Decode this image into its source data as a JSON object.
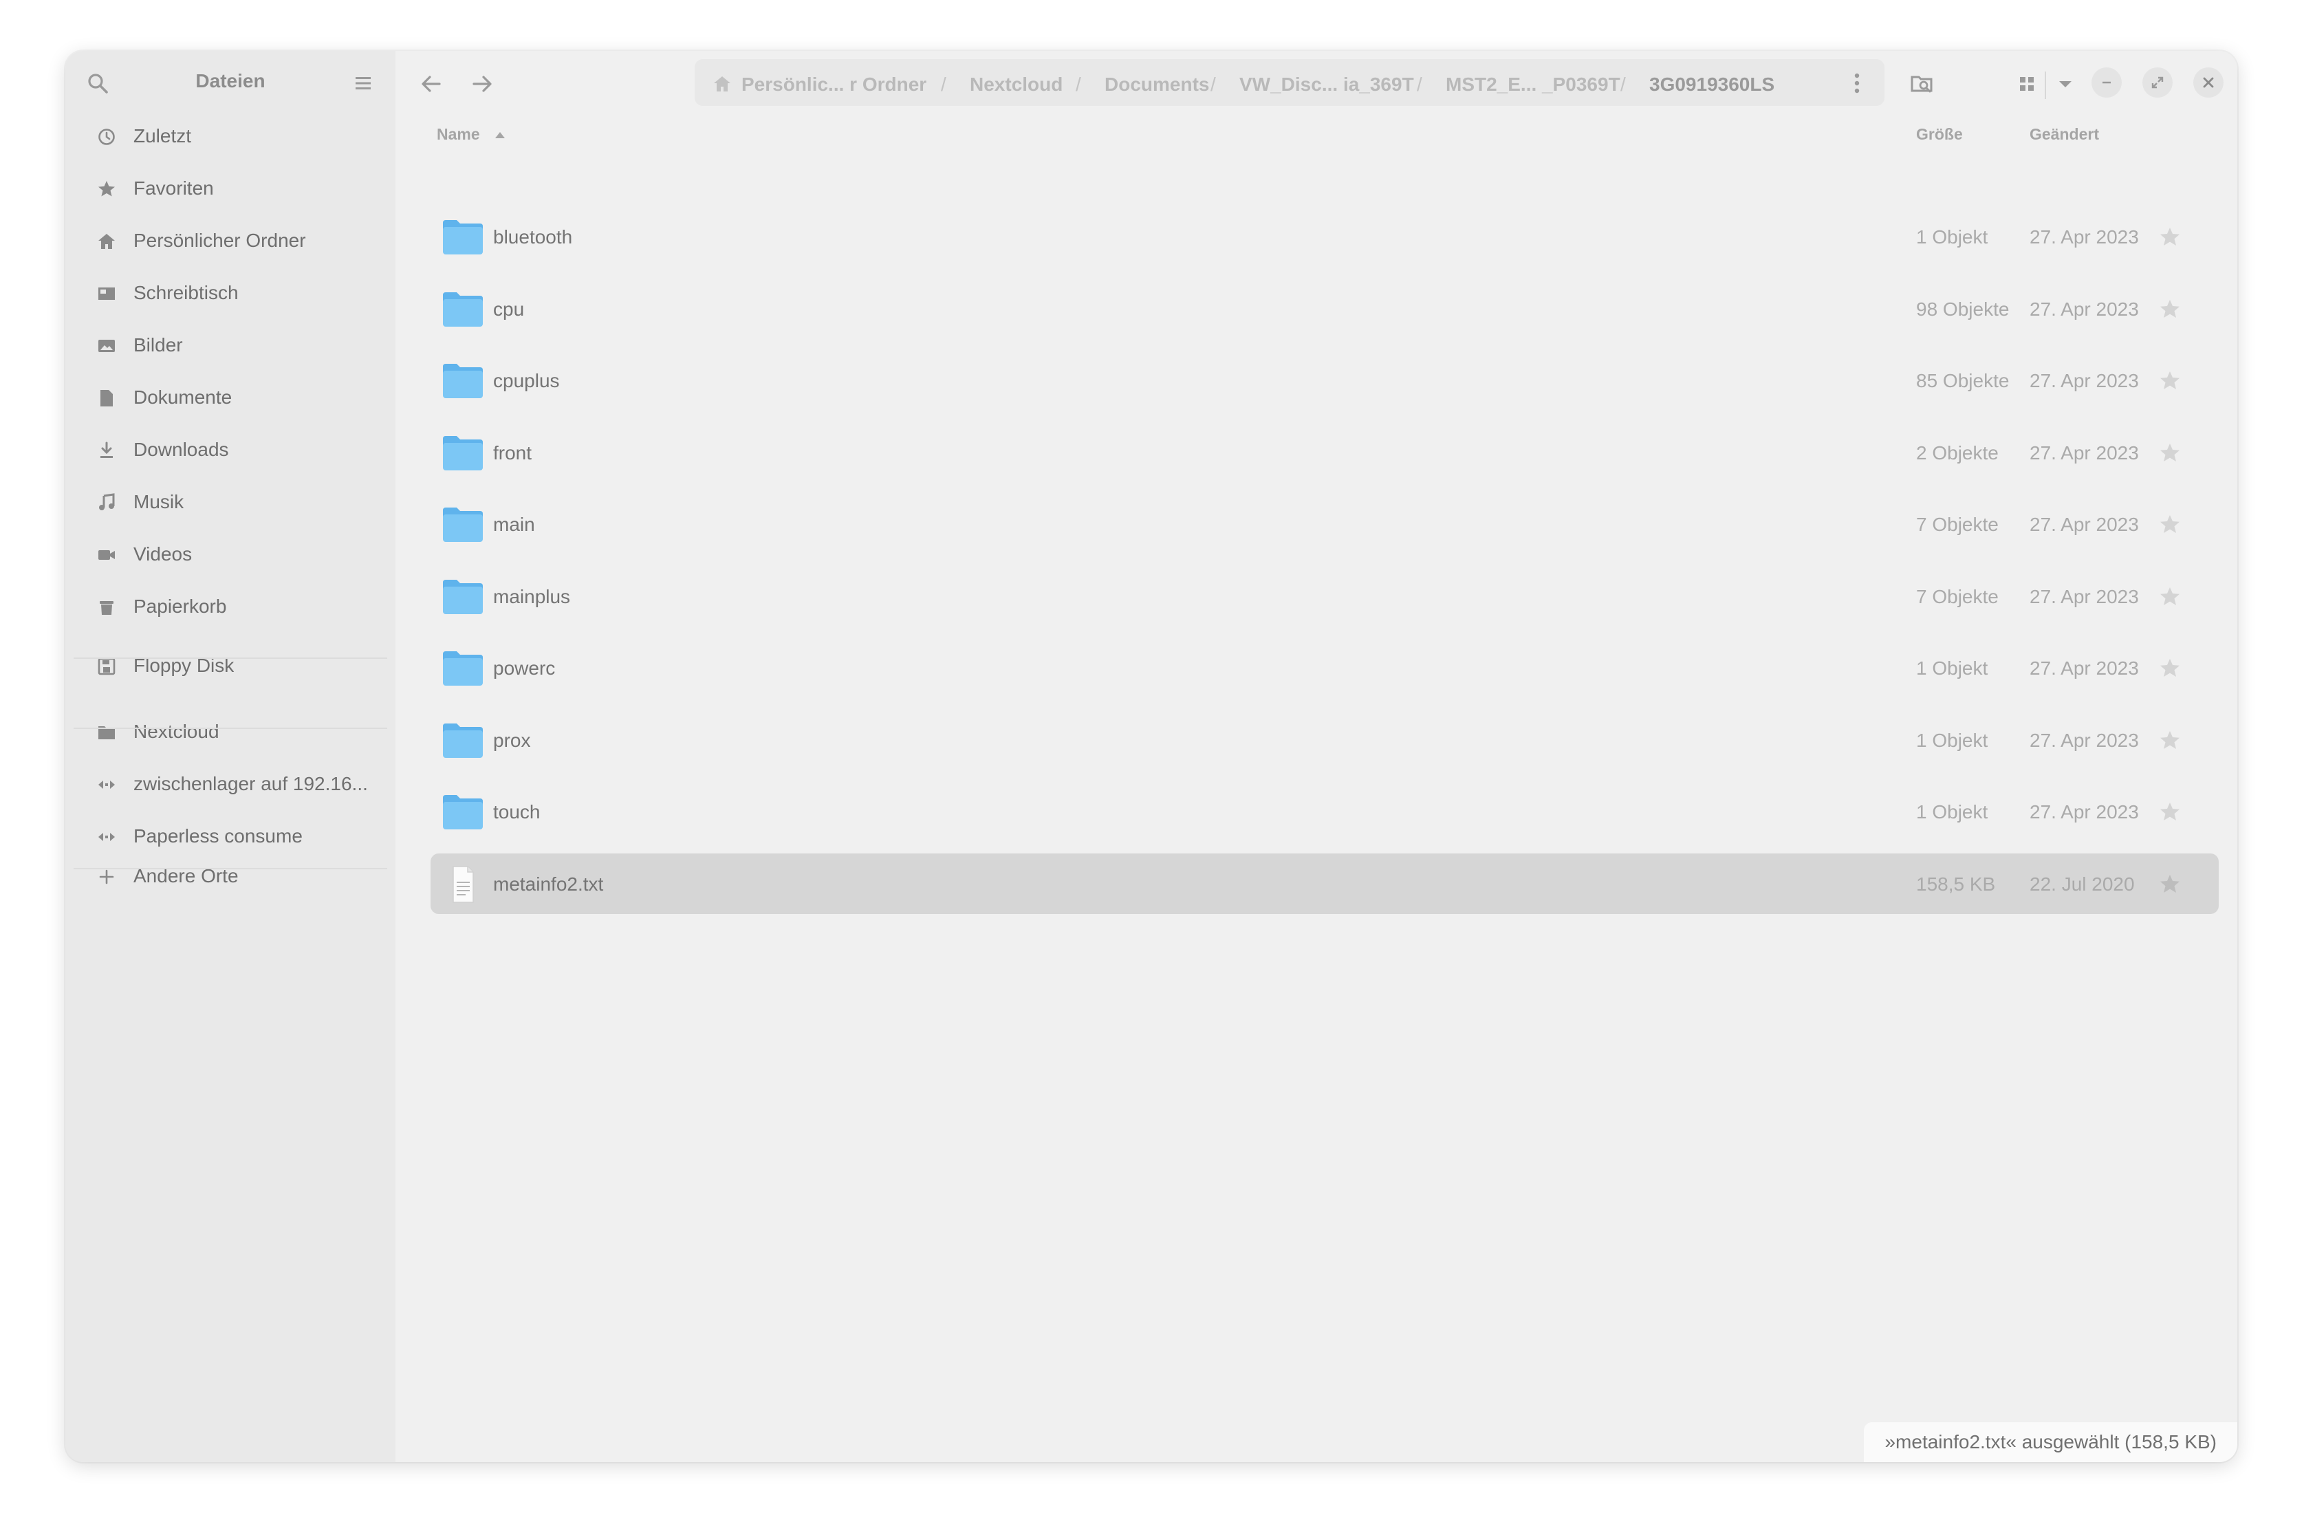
{
  "sidebar": {
    "title": "Dateien",
    "places": [
      {
        "label": "Zuletzt",
        "icon": "clock-icon"
      },
      {
        "label": "Favoriten",
        "icon": "star-icon"
      },
      {
        "label": "Persönlicher Ordner",
        "icon": "home-icon"
      },
      {
        "label": "Schreibtisch",
        "icon": "desktop-icon"
      },
      {
        "label": "Bilder",
        "icon": "image-icon"
      },
      {
        "label": "Dokumente",
        "icon": "document-icon"
      },
      {
        "label": "Downloads",
        "icon": "download-icon"
      },
      {
        "label": "Musik",
        "icon": "music-icon"
      },
      {
        "label": "Videos",
        "icon": "video-icon"
      },
      {
        "label": "Papierkorb",
        "icon": "trash-icon"
      }
    ],
    "devices": [
      {
        "label": "Floppy Disk",
        "icon": "floppy-icon"
      }
    ],
    "bookmarks": [
      {
        "label": "Nextcloud",
        "icon": "folder-icon"
      },
      {
        "label": "zwischenlager auf 192.16...",
        "icon": "network-share-icon"
      },
      {
        "label": "Paperless consume",
        "icon": "network-share-icon"
      }
    ],
    "other_locations": {
      "label": "Andere Orte",
      "icon": "plus-icon"
    }
  },
  "breadcrumbs": [
    "Persönlic... r Ordner",
    "Nextcloud",
    "Documents",
    "VW_Disc... ia_369T",
    "MST2_E... _P0369T",
    "3G0919360LS"
  ],
  "breadcrumb_separator": "/",
  "columns": {
    "name": "Name",
    "size": "Größe",
    "modified": "Geändert"
  },
  "files": [
    {
      "name": "bluetooth",
      "type": "folder",
      "size": "1 Objekt",
      "modified": "27. Apr 2023",
      "selected": false
    },
    {
      "name": "cpu",
      "type": "folder",
      "size": "98 Objekte",
      "modified": "27. Apr 2023",
      "selected": false
    },
    {
      "name": "cpuplus",
      "type": "folder",
      "size": "85 Objekte",
      "modified": "27. Apr 2023",
      "selected": false
    },
    {
      "name": "front",
      "type": "folder",
      "size": "2 Objekte",
      "modified": "27. Apr 2023",
      "selected": false
    },
    {
      "name": "main",
      "type": "folder",
      "size": "7 Objekte",
      "modified": "27. Apr 2023",
      "selected": false
    },
    {
      "name": "mainplus",
      "type": "folder",
      "size": "7 Objekte",
      "modified": "27. Apr 2023",
      "selected": false
    },
    {
      "name": "powerc",
      "type": "folder",
      "size": "1 Objekt",
      "modified": "27. Apr 2023",
      "selected": false
    },
    {
      "name": "prox",
      "type": "folder",
      "size": "1 Objekt",
      "modified": "27. Apr 2023",
      "selected": false
    },
    {
      "name": "touch",
      "type": "folder",
      "size": "1 Objekt",
      "modified": "27. Apr 2023",
      "selected": false
    },
    {
      "name": "metainfo2.txt",
      "type": "text-file",
      "size": "158,5 KB",
      "modified": "22. Jul 2020",
      "selected": true
    }
  ],
  "status": "»metainfo2.txt« ausgewählt  (158,5 KB)",
  "colors": {
    "folder_body": "#7cc7f5",
    "folder_tab": "#5fb3ec",
    "selection": "#d6d6d6",
    "sidebar_bg": "#e9e9e9",
    "content_bg": "#f0f0f0"
  }
}
